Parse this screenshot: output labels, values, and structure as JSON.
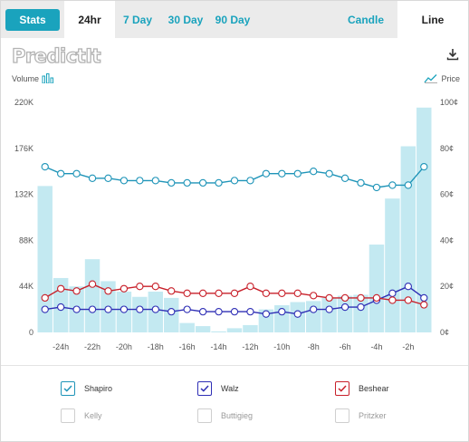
{
  "tabs": {
    "stats_label": "Stats",
    "ranges": [
      "24hr",
      "7 Day",
      "30 Day",
      "90 Day"
    ],
    "active_range": "24hr",
    "views": [
      "Candle",
      "Line"
    ],
    "active_view": "Line"
  },
  "logo_text": "PredictIt",
  "legend": {
    "volume_label": "Volume",
    "price_label": "Price"
  },
  "colors": {
    "accent": "#1aa3bd",
    "volume_bar": "#c3e9f1",
    "Shapiro": "#1e94b8",
    "Walz": "#2e2eb5",
    "Beshear": "#c8202a"
  },
  "chart_data": {
    "type": "line",
    "x": [
      "-25h",
      "-24h",
      "-23h",
      "-22h",
      "-21h",
      "-20h",
      "-19h",
      "-18h",
      "-17h",
      "-16h",
      "-15h",
      "-14h",
      "-13h",
      "-12h",
      "-11h",
      "-10h",
      "-9h",
      "-8h",
      "-7h",
      "-6h",
      "-5h",
      "-4h",
      "-3h",
      "-2h",
      "-1h"
    ],
    "x_tick_labels": [
      "-24h",
      "-22h",
      "-20h",
      "-18h",
      "-16h",
      "-14h",
      "-12h",
      "-10h",
      "-8h",
      "-6h",
      "-4h",
      "-2h"
    ],
    "volume": {
      "axis": "left",
      "ylim": [
        0,
        220000
      ],
      "ticks": [
        "0",
        "44K",
        "88K",
        "132K",
        "176K",
        "220K"
      ],
      "values": [
        140000,
        52000,
        44000,
        70000,
        49000,
        39000,
        34000,
        39000,
        33000,
        9000,
        6000,
        1000,
        4000,
        7000,
        22000,
        26000,
        29000,
        30000,
        33000,
        35000,
        36000,
        84000,
        128000,
        178000,
        215000
      ]
    },
    "price": {
      "axis": "right",
      "ylim": [
        0,
        100
      ],
      "ticks": [
        "0¢",
        "20¢",
        "40¢",
        "60¢",
        "80¢",
        "100¢"
      ],
      "series": [
        {
          "name": "Shapiro",
          "values": [
            72,
            69,
            69,
            67,
            67,
            66,
            66,
            66,
            65,
            65,
            65,
            65,
            66,
            66,
            69,
            69,
            69,
            70,
            69,
            67,
            65,
            63,
            64,
            64,
            72
          ]
        },
        {
          "name": "Walz",
          "values": [
            10,
            11,
            10,
            10,
            10,
            10,
            10,
            10,
            9,
            10,
            9,
            9,
            9,
            9,
            8,
            9,
            8,
            10,
            10,
            11,
            11,
            14,
            17,
            20,
            15
          ]
        },
        {
          "name": "Beshear",
          "values": [
            15,
            19,
            18,
            21,
            18,
            19,
            20,
            20,
            18,
            17,
            17,
            17,
            17,
            20,
            17,
            17,
            17,
            16,
            15,
            15,
            15,
            15,
            14,
            14,
            12
          ]
        }
      ]
    }
  },
  "candidates": [
    {
      "name": "Shapiro",
      "checked": true
    },
    {
      "name": "Walz",
      "checked": true
    },
    {
      "name": "Beshear",
      "checked": true
    },
    {
      "name": "Kelly",
      "checked": false
    },
    {
      "name": "Buttigieg",
      "checked": false
    },
    {
      "name": "Pritzker",
      "checked": false
    }
  ]
}
